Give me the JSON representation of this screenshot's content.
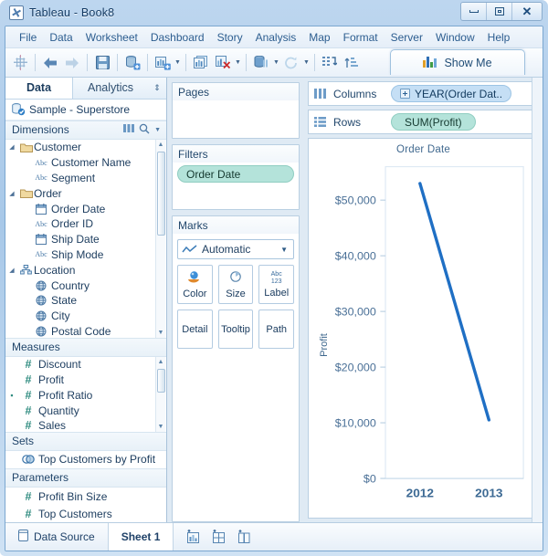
{
  "window": {
    "title": "Tableau - Book8",
    "app_icon": "tableau-logo-icon",
    "controls": {
      "minimize": "Minimize",
      "restore": "Restore",
      "close": "Close"
    }
  },
  "menubar": {
    "items": [
      {
        "label": "File"
      },
      {
        "label": "Data"
      },
      {
        "label": "Worksheet"
      },
      {
        "label": "Dashboard"
      },
      {
        "label": "Story"
      },
      {
        "label": "Analysis"
      },
      {
        "label": "Map"
      },
      {
        "label": "Format"
      },
      {
        "label": "Server"
      },
      {
        "label": "Window"
      },
      {
        "label": "Help"
      }
    ]
  },
  "toolbar": {
    "buttons": [
      {
        "name": "tableau-home-icon",
        "tip": "Tableau Home"
      },
      {
        "name": "back-arrow-icon",
        "tip": "Back"
      },
      {
        "name": "forward-arrow-icon",
        "tip": "Forward"
      },
      {
        "name": "save-icon",
        "tip": "Save"
      },
      {
        "name": "new-data-source-icon",
        "tip": "New Data Source"
      },
      {
        "name": "new-worksheet-icon",
        "tip": "New Worksheet"
      },
      {
        "name": "duplicate-sheet-icon",
        "tip": "Duplicate Sheet"
      },
      {
        "name": "clear-sheet-icon",
        "tip": "Clear Sheet"
      },
      {
        "name": "pause-auto-update-icon",
        "tip": "Pause Auto Updates"
      },
      {
        "name": "refresh-data-source-icon",
        "tip": "Refresh Data Source"
      },
      {
        "name": "swap-rows-columns-icon",
        "tip": "Swap Rows and Columns"
      },
      {
        "name": "sort-ascending-icon",
        "tip": "Sort Ascending"
      }
    ],
    "show_me_label": "Show Me",
    "show_me_icon": "bar-chart-icon"
  },
  "left_pane": {
    "tabs": [
      {
        "label": "Data",
        "active": true
      },
      {
        "label": "Analytics",
        "active": false
      }
    ],
    "data_source": "Sample - Superstore",
    "dimensions": {
      "header": "Dimensions",
      "items": [
        {
          "label": "Customer",
          "icon": "folder-icon",
          "level": 0,
          "expander": "expanded"
        },
        {
          "label": "Customer Name",
          "icon": "abc-icon",
          "level": 1
        },
        {
          "label": "Segment",
          "icon": "abc-icon",
          "level": 1
        },
        {
          "label": "Order",
          "icon": "folder-icon",
          "level": 0,
          "expander": "expanded"
        },
        {
          "label": "Order Date",
          "icon": "calendar-icon",
          "level": 1
        },
        {
          "label": "Order ID",
          "icon": "abc-icon",
          "level": 1
        },
        {
          "label": "Ship Date",
          "icon": "calendar-icon",
          "level": 1
        },
        {
          "label": "Ship Mode",
          "icon": "abc-icon",
          "level": 1
        },
        {
          "label": "Location",
          "icon": "hierarchy-icon",
          "level": 0,
          "expander": "expanded"
        },
        {
          "label": "Country",
          "icon": "globe-icon",
          "level": 1
        },
        {
          "label": "State",
          "icon": "globe-icon",
          "level": 1
        },
        {
          "label": "City",
          "icon": "globe-icon",
          "level": 1
        },
        {
          "label": "Postal Code",
          "icon": "globe-icon",
          "level": 1
        }
      ]
    },
    "measures": {
      "header": "Measures",
      "items": [
        {
          "label": "Discount",
          "icon": "number-icon"
        },
        {
          "label": "Profit",
          "icon": "number-icon"
        },
        {
          "label": "Profit Ratio",
          "icon": "calculated-number-icon"
        },
        {
          "label": "Quantity",
          "icon": "number-icon"
        },
        {
          "label": "Sales",
          "icon": "number-icon"
        }
      ]
    },
    "sets": {
      "header": "Sets",
      "items": [
        {
          "label": "Top Customers by Profit",
          "icon": "set-icon"
        }
      ]
    },
    "parameters": {
      "header": "Parameters",
      "items": [
        {
          "label": "Profit Bin Size",
          "icon": "number-icon"
        },
        {
          "label": "Top Customers",
          "icon": "number-icon"
        }
      ]
    }
  },
  "center_pane": {
    "pages": {
      "title": "Pages",
      "items": []
    },
    "filters": {
      "title": "Filters",
      "items": [
        {
          "label": "Order Date",
          "color": "green"
        }
      ]
    },
    "marks": {
      "title": "Marks",
      "mark_type": "Automatic",
      "mark_type_icon": "line-chart-icon",
      "buttons": [
        {
          "label": "Color",
          "icon": "color-palette-icon"
        },
        {
          "label": "Size",
          "icon": "size-circle-icon"
        },
        {
          "label": "Label",
          "icon": "abc-123-icon"
        },
        {
          "label": "Detail",
          "icon": ""
        },
        {
          "label": "Tooltip",
          "icon": ""
        },
        {
          "label": "Path",
          "icon": ""
        }
      ]
    }
  },
  "shelves": {
    "columns": {
      "label": "Columns",
      "icon": "columns-icon",
      "pills": [
        {
          "label": "YEAR(Order Dat..",
          "color": "blue",
          "expandable": true
        }
      ]
    },
    "rows": {
      "label": "Rows",
      "icon": "rows-icon",
      "pills": [
        {
          "label": "SUM(Profit)",
          "color": "green",
          "expandable": false
        }
      ]
    }
  },
  "chart_data": {
    "type": "line",
    "title": "Order Date",
    "xlabel": "",
    "ylabel": "Profit",
    "categories": [
      "2012",
      "2013"
    ],
    "x": [
      2012,
      2013
    ],
    "series": [
      {
        "name": "SUM(Profit)",
        "values": [
          53000,
          10500
        ],
        "color": "#1f6fc4"
      }
    ],
    "ytick_labels": [
      "$0",
      "$10,000",
      "$20,000",
      "$30,000",
      "$40,000",
      "$50,000"
    ],
    "ytick_values": [
      0,
      10000,
      20000,
      30000,
      40000,
      50000
    ],
    "ylim": [
      0,
      56000
    ],
    "grid": false,
    "legend": "none",
    "line_color": "#1f6fc4",
    "line_width": 3
  },
  "statusbar": {
    "data_source_tab": {
      "label": "Data Source",
      "icon": "data-source-icon"
    },
    "sheet_tabs": [
      {
        "label": "Sheet 1",
        "active": true
      }
    ],
    "new_buttons": [
      {
        "name": "new-worksheet-icon",
        "tip": "New Worksheet"
      },
      {
        "name": "new-dashboard-icon",
        "tip": "New Dashboard"
      },
      {
        "name": "new-story-icon",
        "tip": "New Story"
      }
    ]
  }
}
